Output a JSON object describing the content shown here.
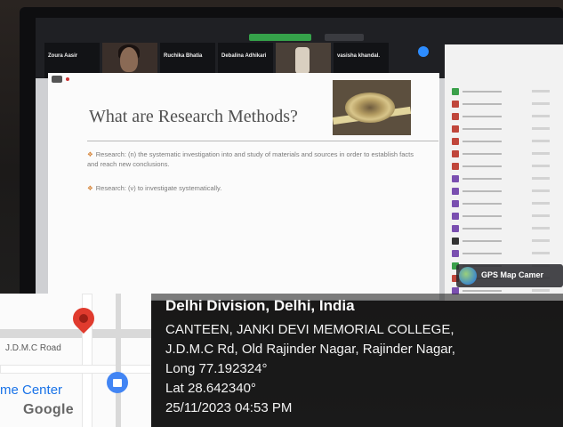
{
  "meeting": {
    "status_label": "",
    "view_options_label": "",
    "participants": [
      {
        "name": "Zoura Aasir",
        "sub": ""
      },
      {
        "name": "",
        "sub": ""
      },
      {
        "name": "Ruchika Bhatia",
        "sub": ""
      },
      {
        "name": "Debalina Adhikari",
        "sub": ""
      },
      {
        "name": "",
        "sub": ""
      },
      {
        "name": "vasisha khandal.",
        "sub": ""
      }
    ],
    "participant_count": ""
  },
  "slide": {
    "title": "What are Research Methods?",
    "bullets": [
      "Research: (n) the systematic investigation into and study of materials and sources in order to establish facts and reach new conclusions.",
      "Research: (v) to investigate systematically."
    ],
    "bullet_marker": "❖"
  },
  "panel": {
    "avatar_colors": [
      "#3aa04a",
      "#c0463b",
      "#c0463b",
      "#c0463b",
      "#c0463b",
      "#c0463b",
      "#c0463b",
      "#7a4fb0",
      "#7a4fb0",
      "#7a4fb0",
      "#7a4fb0",
      "#7a4fb0",
      "#333333",
      "#7a4fb0",
      "#3aa04a",
      "#c0463b",
      "#7a4fb0"
    ]
  },
  "gps_badge": {
    "label": "GPS Map Camer"
  },
  "map": {
    "road_label": "J.D.M.C Road",
    "place_label": "me Center",
    "brand": "Google"
  },
  "location": {
    "title": "Delhi Division, Delhi, India",
    "lines": [
      "CANTEEN, JANKI DEVI MEMORIAL COLLEGE,",
      "J.D.M.C Rd, Old Rajinder Nagar, Rajinder Nagar,",
      "Long 77.192324°",
      "Lat 28.642340°",
      "25/11/2023 04:53 PM"
    ]
  }
}
